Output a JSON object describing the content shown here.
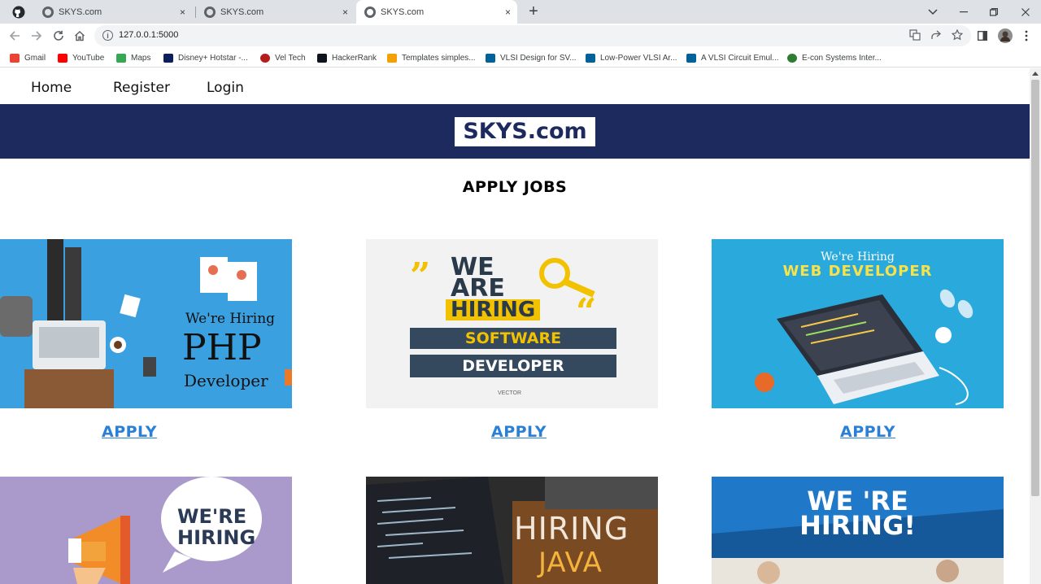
{
  "browser": {
    "tabs": [
      {
        "title": "SKYS.com"
      },
      {
        "title": "SKYS.com"
      },
      {
        "title": "SKYS.com"
      }
    ],
    "new_tab": "+",
    "tab_close": "×",
    "url": "127.0.0.1:5000",
    "bookmarks": [
      {
        "label": "Gmail",
        "color": "#ea4335"
      },
      {
        "label": "YouTube",
        "color": "#ff0000"
      },
      {
        "label": "Maps",
        "color": "#34a853"
      },
      {
        "label": "Disney+ Hotstar -...",
        "color": "#0c1e5b"
      },
      {
        "label": "Vel Tech",
        "color": "#b71c1c"
      },
      {
        "label": "HackerRank",
        "color": "#0e141e"
      },
      {
        "label": "Templates simples...",
        "color": "#f4a000"
      },
      {
        "label": "VLSI Design for SV...",
        "color": "#00629b"
      },
      {
        "label": "Low-Power VLSI Ar...",
        "color": "#00629b"
      },
      {
        "label": "A VLSI Circuit Emul...",
        "color": "#00629b"
      },
      {
        "label": "E-con Systems Inter...",
        "color": "#2e7d32"
      }
    ]
  },
  "nav": {
    "home": "Home",
    "register": "Register",
    "login": "Login"
  },
  "brand": "SKYS.com",
  "heading": "APPLY JOBS",
  "cards": [
    {
      "apply": "APPLY",
      "img": {
        "line1": "We're Hiring",
        "line2": "PHP",
        "line3": "Developer"
      }
    },
    {
      "apply": "APPLY",
      "img": {
        "line1": "WE",
        "line2": "ARE",
        "line3": "HIRING",
        "line4": "SOFTWARE",
        "line5": "DEVELOPER",
        "tag": "VECTOR"
      }
    },
    {
      "apply": "APPLY",
      "img": {
        "line1": "We're Hiring",
        "line2": "WEB DEVELOPER"
      }
    },
    {
      "img": {
        "line1": "WE'RE",
        "line2": "HIRING"
      }
    },
    {
      "img": {
        "line1": "HIRING",
        "line2": "JAVA"
      }
    },
    {
      "img": {
        "line1": "WE 'RE",
        "line2": "HIRING!"
      }
    }
  ],
  "colors": {
    "banner": "#1c2a5e",
    "link": "#2a80d6"
  }
}
